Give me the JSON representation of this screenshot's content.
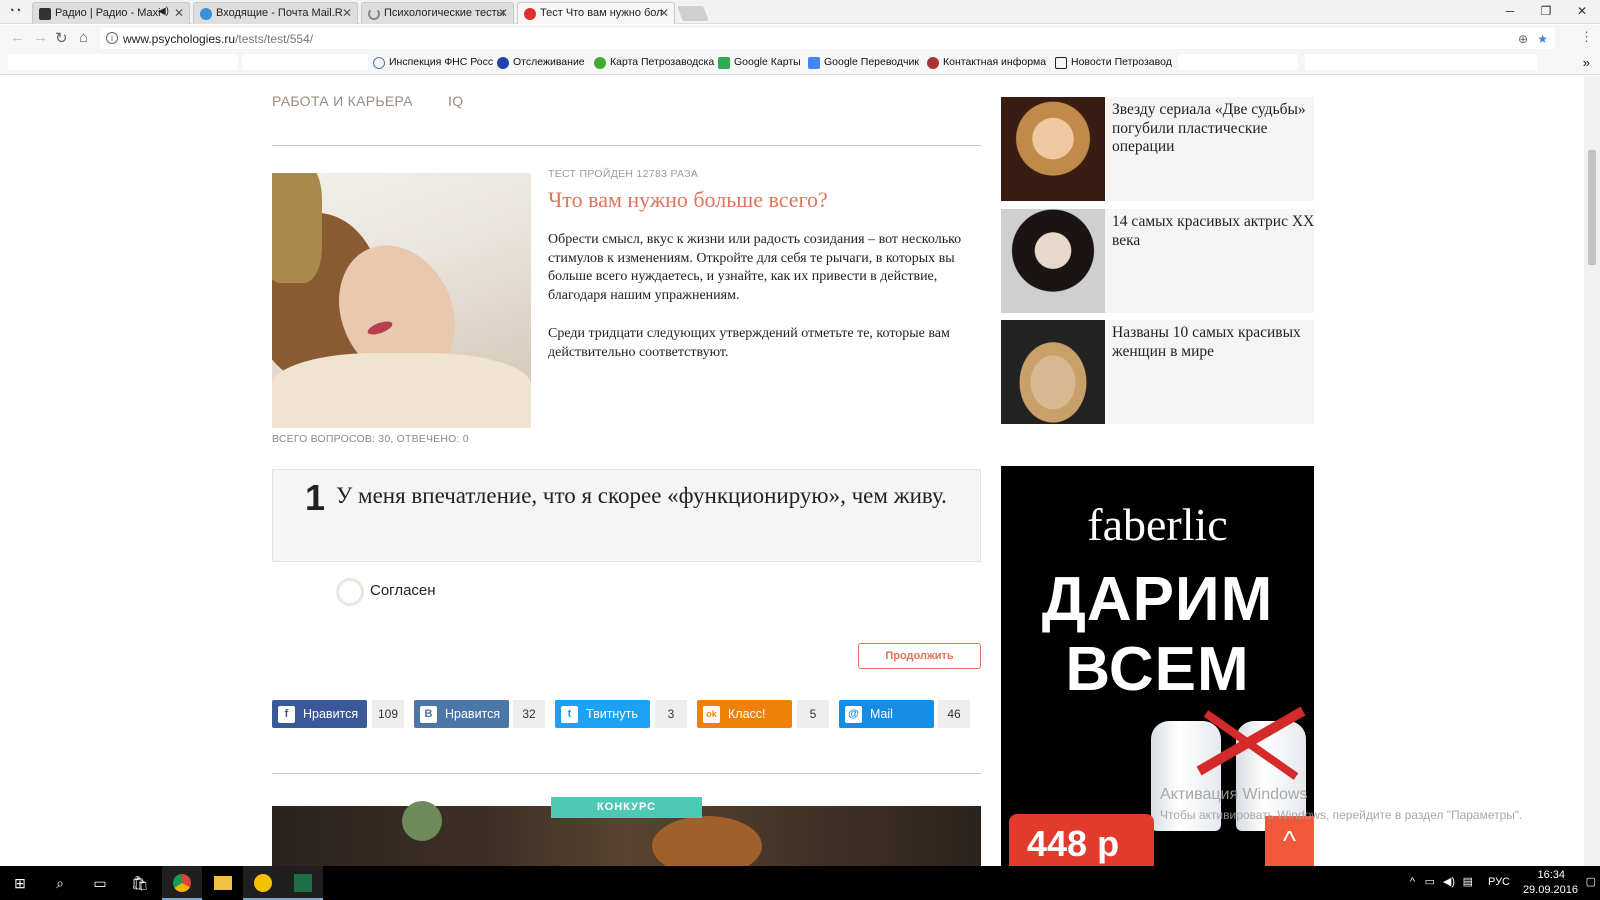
{
  "browser": {
    "tabs": [
      {
        "title": "Радио | Радио - Maxi",
        "active": false,
        "icon": "radio-icon",
        "color": "#333333"
      },
      {
        "title": "Входящие - Почта Mail.R",
        "active": false,
        "icon": "mail-icon",
        "color": "#3a8fd6"
      },
      {
        "title": "Психологические тесты",
        "active": false,
        "icon": "loading-icon",
        "color": "#888888"
      },
      {
        "title": "Тест Что вам нужно бол",
        "active": true,
        "icon": "opera-icon",
        "color": "#e0302c"
      }
    ],
    "window_controls": {
      "minimize": "─",
      "restore": "❐",
      "close": "✕"
    },
    "url_host": "www.psychologies.ru",
    "url_path": "/tests/test/554/",
    "bookmarks": [
      {
        "label": "Инспекция ФНС Росс",
        "icon": "fns-icon",
        "color": "#5577aa"
      },
      {
        "label": "Отслеживание",
        "icon": "tracking-icon",
        "color": "#2244aa"
      },
      {
        "label": "Карта Петрозаводска",
        "icon": "map-icon",
        "color": "#44aa33"
      },
      {
        "label": "Google Карты",
        "icon": "google-maps-icon",
        "color": "#34a853"
      },
      {
        "label": "Google Переводчик",
        "icon": "google-translate-icon",
        "color": "#4285f4"
      },
      {
        "label": "Контактная информа",
        "icon": "contact-icon",
        "color": "#aa3333"
      },
      {
        "label": "Новости Петрозавод",
        "icon": "news-icon",
        "color": "#222222"
      }
    ],
    "more_bookmarks": "»"
  },
  "page": {
    "categories": [
      "РАБОТА И КАРЬЕРА",
      "IQ"
    ],
    "test_taken": "ТЕСТ ПРОЙДЕН 12783 РАЗА",
    "test_title": "Что вам нужно больше всего?",
    "intro_1": "Обрести смысл, вкус к жизни или радость созидания – вот несколько стимулов к изменениям. Откройте для себя те рычаги, в которых вы больше всего нуждаетесь, и узнайте, как их привести в действие, благодаря нашим упражнениям.",
    "intro_2": "Среди тридцати следующих утверждений отметьте те, которые вам действительно соответствуют.",
    "question_count": "ВСЕГО ВОПРОСОВ: 30, ОТВЕЧЕНО: 0",
    "question_number": "1",
    "question_text": "У меня впечатление, что я скорее «функционирую», чем живу.",
    "answer_label": "Согласен",
    "continue_label": "Продолжить",
    "accent_color": "#e0745c",
    "share": [
      {
        "label": "Нравится",
        "count": "109",
        "icon": "facebook-icon",
        "glyph": "f",
        "color": "#3b5998"
      },
      {
        "label": "Нравится",
        "count": "32",
        "icon": "vk-icon",
        "glyph": "B",
        "color": "#4a76a8"
      },
      {
        "label": "Твитнуть",
        "count": "3",
        "icon": "twitter-icon",
        "glyph": "t",
        "color": "#1da1f2"
      },
      {
        "label": "Класс!",
        "count": "5",
        "icon": "odnoklassniki-icon",
        "glyph": "ok",
        "color": "#ee8208"
      },
      {
        "label": "Mail",
        "count": "46",
        "icon": "mailru-icon",
        "glyph": "@",
        "color": "#168de2"
      }
    ],
    "contest_badge": "КОНКУРС"
  },
  "sidebar": {
    "articles": [
      {
        "title": "Звезду сериала «Две судьбы» погубили пластические операции"
      },
      {
        "title": "14 самых красивых актрис XX века"
      },
      {
        "title": "Названы 10 самых красивых женщин в мире"
      }
    ],
    "ad": {
      "brand": "faberlic",
      "headline_1": "ДАРИМ",
      "headline_2": "ВСЕМ",
      "price": "448 р",
      "scroll_top": "^"
    }
  },
  "windows": {
    "activation_title": "Активация Windows",
    "activation_text": "Чтобы активировать Windows, перейдите в раздел \"Параметры\".",
    "language": "РУС",
    "time": "16:34",
    "date": "29.09.2016"
  }
}
